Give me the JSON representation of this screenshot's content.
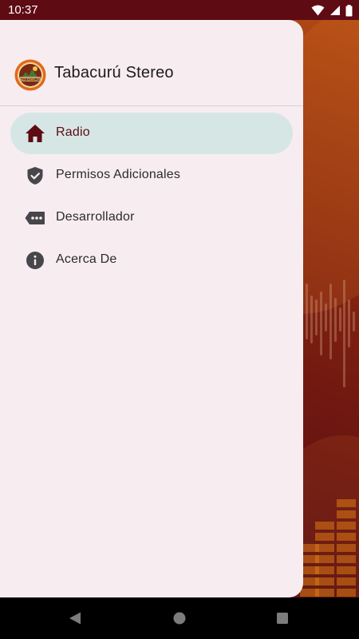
{
  "status_bar": {
    "time": "10:37",
    "icons": [
      "wifi-icon",
      "signal-icon",
      "battery-icon"
    ]
  },
  "drawer": {
    "app_title": "Tabacurú Stereo",
    "logo_text": "TABACURÚ",
    "items": [
      {
        "label": "Radio",
        "icon": "home-icon",
        "active": true
      },
      {
        "label": "Permisos Adicionales",
        "icon": "shield-check-icon",
        "active": false
      },
      {
        "label": "Desarrollador",
        "icon": "dots-tag-icon",
        "active": false
      },
      {
        "label": "Acerca De",
        "icon": "info-icon",
        "active": false
      }
    ]
  },
  "nav_bar": {
    "buttons": [
      "back-icon",
      "home-circle-icon",
      "recents-icon"
    ]
  },
  "colors": {
    "primary": "#5e0b14",
    "drawer_bg": "#f7edf0",
    "active_item_bg": "#d6e6e5",
    "accent_orange": "#e06a1b"
  }
}
